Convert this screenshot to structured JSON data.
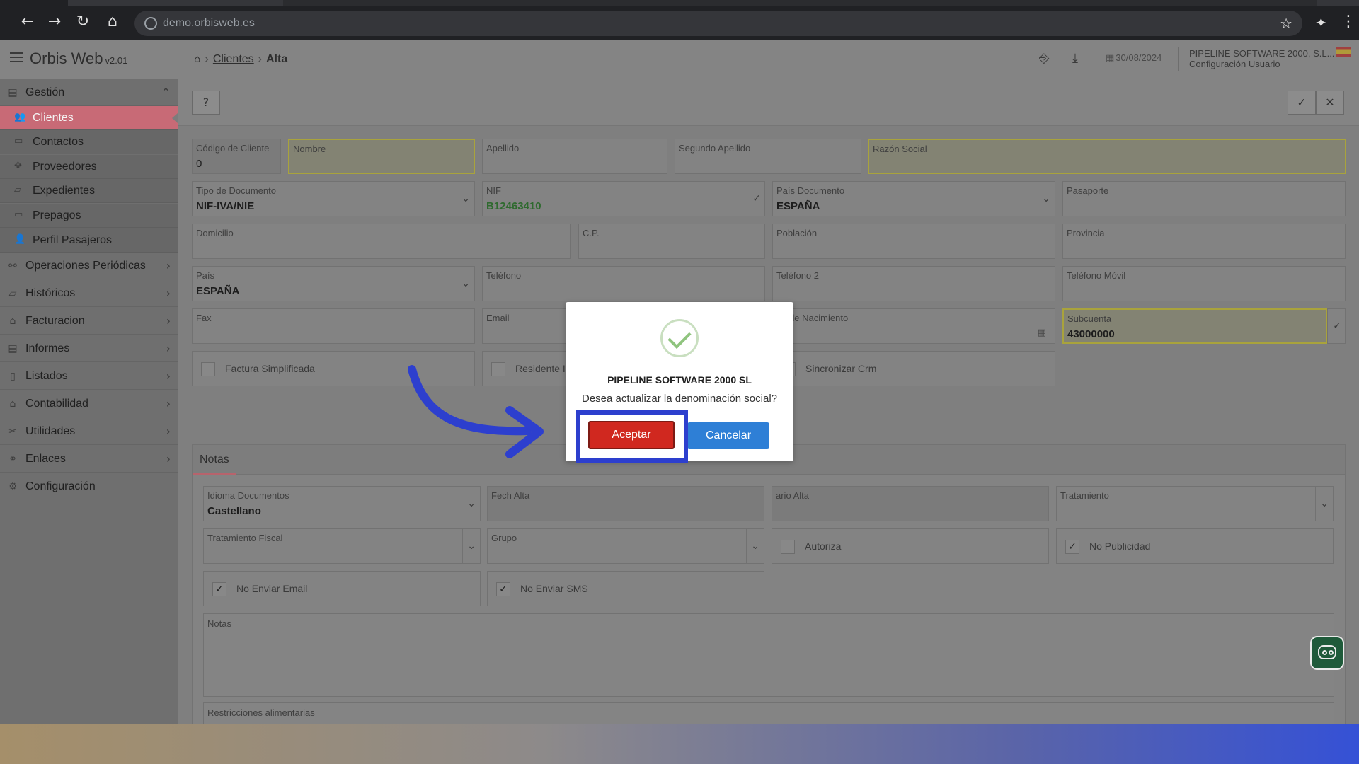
{
  "browser": {
    "url": "demo.orbisweb.es"
  },
  "app": {
    "name": "Orbis Web",
    "version": "v2.01"
  },
  "breadcrumb": {
    "section": "Clientes",
    "current": "Alta"
  },
  "header": {
    "date": "30/08/2024",
    "company": "PIPELINE SOFTWARE 2000, S.L...",
    "user_config": "Configuración Usuario"
  },
  "sidebar": {
    "group_gestion": "Gestión",
    "gestion_items": [
      "Clientes",
      "Contactos",
      "Proveedores",
      "Expedientes",
      "Prepagos",
      "Perfil Pasajeros"
    ],
    "groups": [
      "Operaciones Periódicas",
      "Históricos",
      "Facturacion",
      "Informes",
      "Listados",
      "Contabilidad",
      "Utilidades",
      "Enlaces",
      "Configuración"
    ]
  },
  "form": {
    "codigo_cliente": {
      "label": "Código de Cliente",
      "value": "0"
    },
    "nombre": {
      "label": "Nombre",
      "value": ""
    },
    "apellido": {
      "label": "Apellido",
      "value": ""
    },
    "segundo_apellido": {
      "label": "Segundo Apellido",
      "value": ""
    },
    "razon_social": {
      "label": "Razón Social",
      "value": ""
    },
    "tipo_documento": {
      "label": "Tipo de Documento",
      "value": "NIF-IVA/NIE"
    },
    "nif": {
      "label": "NIF",
      "value": "B12463410"
    },
    "pais_documento": {
      "label": "País Documento",
      "value": "ESPAÑA"
    },
    "pasaporte": {
      "label": "Pasaporte",
      "value": ""
    },
    "domicilio": {
      "label": "Domicilio",
      "value": ""
    },
    "cp": {
      "label": "C.P.",
      "value": ""
    },
    "poblacion": {
      "label": "Población",
      "value": ""
    },
    "provincia": {
      "label": "Provincia",
      "value": ""
    },
    "pais": {
      "label": "País",
      "value": "ESPAÑA"
    },
    "telefono": {
      "label": "Teléfono",
      "value": ""
    },
    "telefono2": {
      "label": "Teléfono 2",
      "value": ""
    },
    "telefono_movil": {
      "label": "Teléfono Móvil",
      "value": ""
    },
    "fax": {
      "label": "Fax",
      "value": ""
    },
    "email": {
      "label": "Email",
      "value": ""
    },
    "fecha_nacimiento": {
      "label": "na de Nacimiento",
      "value": ""
    },
    "subcuenta": {
      "label": "Subcuenta",
      "value": "43000000"
    },
    "factura_simplificada": "Factura Simplificada",
    "residente": "Residente Is",
    "sincronizar_crm": "Sincronizar Crm"
  },
  "notes": {
    "tab_label": "Notas",
    "idioma": {
      "label": "Idioma Documentos",
      "value": "Castellano"
    },
    "fecha_alta": {
      "label": "Fech   Alta"
    },
    "usuario_alta": {
      "label": "ario Alta"
    },
    "tratamiento": {
      "label": "Tratamiento"
    },
    "tratamiento_fiscal": {
      "label": "Tratamiento Fiscal"
    },
    "grupo": {
      "label": "Grupo"
    },
    "autoriza": "Autoriza",
    "no_publicidad": "No Publicidad",
    "no_enviar_email": "No Enviar Email",
    "no_enviar_sms": "No Enviar SMS",
    "notas_label": "Notas",
    "restricciones_label": "Restricciones alimentarias"
  },
  "modal": {
    "title": "PIPELINE SOFTWARE 2000 SL",
    "message": "Desea actualizar la denominación social?",
    "accept": "Aceptar",
    "cancel": "Cancelar"
  },
  "colors": {
    "accept": "#d0281f",
    "cancel": "#2e7fd6",
    "highlight_box": "#2d3fce",
    "active_menu": "#c86a76"
  }
}
